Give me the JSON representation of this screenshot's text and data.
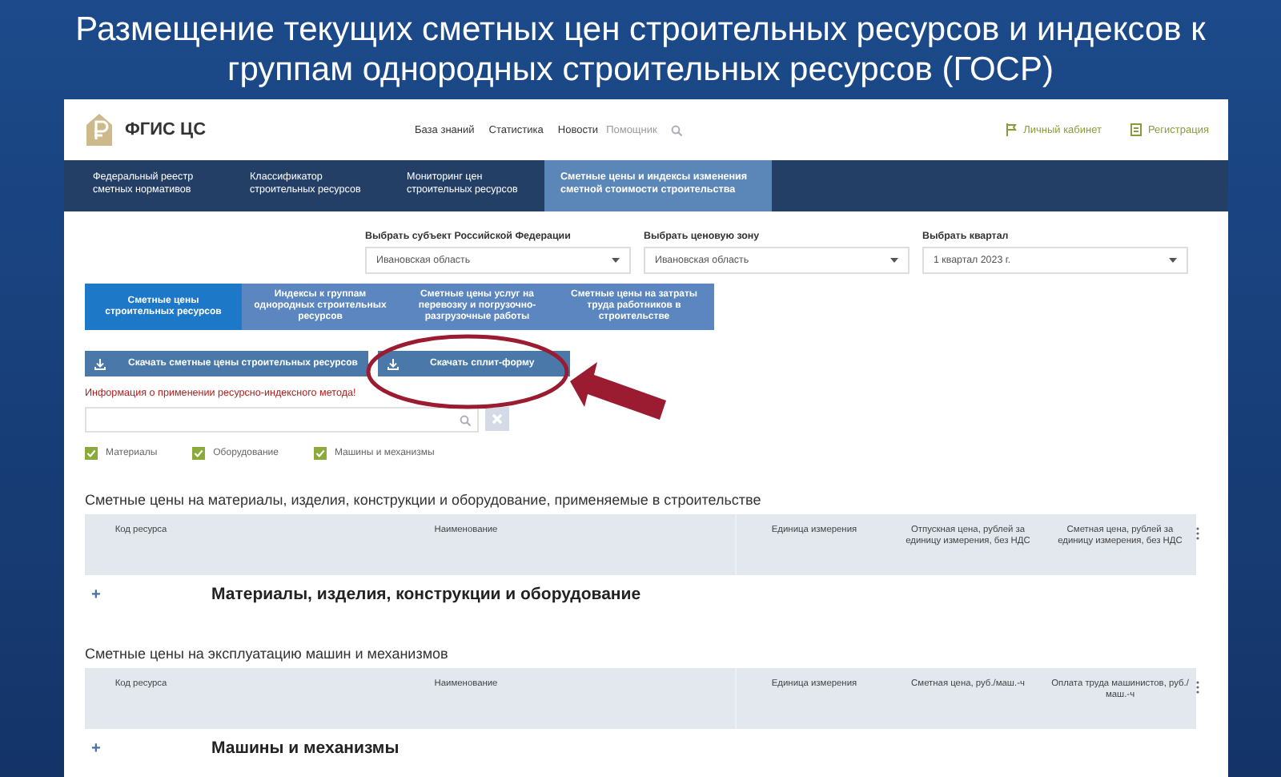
{
  "slide_title": "Размещение текущих сметных цен строительных ресурсов и индексов к группам однородных строительных ресурсов (ГОСР)",
  "site": {
    "logo_text": "ФГИС ЦС",
    "top_links": [
      "База знаний",
      "Статистика",
      "Новости",
      "Помощник"
    ],
    "account_links": [
      {
        "kind": "cabinet",
        "label": "Личный кабинет"
      },
      {
        "kind": "register",
        "label": "Регистрация"
      }
    ],
    "nav": [
      {
        "label": "Федеральный реестр сметных нормативов",
        "selected": false
      },
      {
        "label": "Классификатор строительных ресурсов",
        "selected": false
      },
      {
        "label": "Мониторинг цен строительных ресурсов",
        "selected": false
      },
      {
        "label": "Сметные цены и индексы изменения сметной стоимости строительства",
        "selected": true
      }
    ],
    "filters": [
      {
        "label": "Выбрать субъект Российской Федерации",
        "value": "Ивановская область"
      },
      {
        "label": "Выбрать ценовую зону",
        "value": "Ивановская область"
      },
      {
        "label": "Выбрать квартал",
        "value": "1 квартал 2023 г."
      }
    ],
    "tabs": [
      {
        "label": "Сметные цены строительных ресурсов",
        "selected": true
      },
      {
        "label": "Индексы к группам однородных строительных ресурсов",
        "selected": false
      },
      {
        "label": "Сметные цены услуг на перевозку и погрузочно-разгрузочные работы",
        "selected": false
      },
      {
        "label": "Сметные цены на затраты труда работников в строительстве",
        "selected": false
      }
    ],
    "buttons": [
      "Скачать сметные цены строительных ресурсов",
      "Скачать сплит-форму"
    ],
    "info_link": "Информация о применении ресурсно-индексного метода!",
    "checkboxes": [
      {
        "label": "Материалы",
        "checked": true
      },
      {
        "label": "Оборудование",
        "checked": true
      },
      {
        "label": "Машины и механизмы",
        "checked": true
      }
    ],
    "tables": [
      {
        "title": "Сметные цены на материалы, изделия, конструкции и оборудование, применяемые в строительстве",
        "columns": [
          "Код ресурса",
          "Наименование",
          "Единица измерения",
          "Отпускная цена, рублей за единицу измерения, без НДС",
          "Сметная цена, рублей за единицу измерения, без НДС"
        ],
        "group_row": {
          "expander": "+",
          "label": "Материалы, изделия, конструкции и оборудование"
        }
      },
      {
        "title": "Сметные цены на эксплуатацию машин и механизмов",
        "columns": [
          "Код ресурса",
          "Наименование",
          "Единица измерения",
          "Сметная цена, руб./маш.-ч",
          "Оплата труда машинистов, руб./маш.-ч"
        ],
        "group_row": {
          "expander": "+",
          "label": "Машины и механизмы"
        }
      }
    ]
  }
}
